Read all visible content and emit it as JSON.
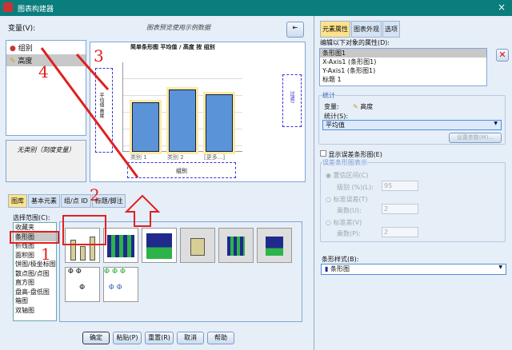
{
  "window": {
    "title": "图表构建器",
    "close": "×"
  },
  "left": {
    "variables_label": "变量(V):",
    "preview_note": "图表预览使用示例数据",
    "variables": [
      {
        "name": "组别",
        "type": "nominal"
      },
      {
        "name": "高度",
        "type": "scale"
      }
    ],
    "no_category": "无类别（刻度变量）",
    "chart": {
      "title": "简单条形图 平均值 / 高度 按 组别",
      "ylabel": "平均值 高度",
      "xlabel": "组别",
      "filter": "过滤?",
      "categories": [
        "类别 1",
        "类别 2",
        "[更多...]"
      ],
      "values": [
        0.62,
        0.78,
        0.72
      ]
    },
    "tabs": [
      "图库",
      "基本元素",
      "组/点 ID",
      "标题/脚注"
    ],
    "choose_from_label": "选择范围(C):",
    "chart_types": [
      "收藏夹",
      "条形图",
      "折线图",
      "面积图",
      "饼图/极坐标图",
      "散点图/点图",
      "直方图",
      "盘高-盘低图",
      "箱图",
      "双轴图"
    ],
    "selected_type": "条形图"
  },
  "buttons": [
    "确定",
    "粘贴(P)",
    "重置(R)",
    "取消",
    "帮助"
  ],
  "right": {
    "tabs": [
      "元素属性",
      "图表外观",
      "选项"
    ],
    "edit_label": "编辑以下对象的属性(D):",
    "objects": [
      "条形图1",
      "X-Axis1 (条形图1)",
      "Y-Axis1 (条形图1)",
      "标题 1"
    ],
    "stats_group": "统计",
    "variable_label": "变量:",
    "variable_value": "高度",
    "statistic_label": "统计(S):",
    "statistic_value": "平均值",
    "set_params": "设置参数(M)...",
    "show_error": "显示误差条形图(E)",
    "error_group": "误差条形图表示",
    "ci": "置信区间(C)",
    "level_label": "级别 (%)(L):",
    "level_value": "95",
    "se": "标准误差(T)",
    "mult1_label": "乘数(U):",
    "mult1_value": "2",
    "sd": "标准差(V)",
    "mult2_label": "乘数(P):",
    "mult2_value": "2",
    "bar_style_label": "条形样式(B):",
    "bar_style_value": "条形图"
  },
  "annotations": [
    "1",
    "2",
    "3",
    "4"
  ]
}
